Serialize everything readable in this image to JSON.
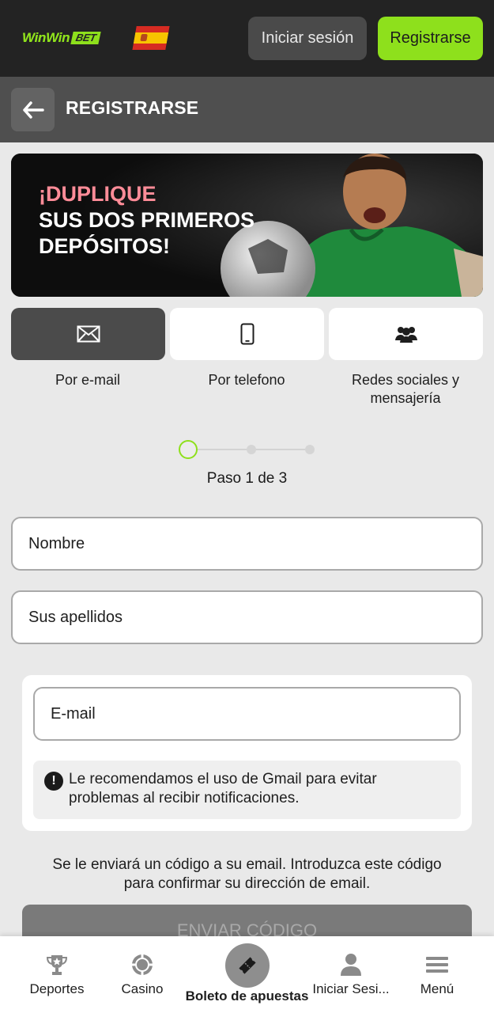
{
  "header": {
    "logo_win": "WinWin",
    "logo_bet": "BET",
    "login_label": "Iniciar sesión",
    "register_label": "Registrarse"
  },
  "subheader": {
    "title": "REGISTRARSE"
  },
  "banner": {
    "line1": "¡DUPLIQUE",
    "line2": "SUS DOS PRIMEROS",
    "line3": "DEPÓSITOS!"
  },
  "tabs": [
    {
      "label": "Por e-mail",
      "icon": "envelope-icon",
      "active": true
    },
    {
      "label": "Por telefono",
      "icon": "phone-icon",
      "active": false
    },
    {
      "label_l1": "Redes sociales y",
      "label_l2": "mensajería",
      "icon": "people-icon",
      "active": false
    }
  ],
  "stepper": {
    "label": "Paso 1 de 3",
    "current": 1,
    "total": 3
  },
  "form": {
    "first_name_placeholder": "Nombre",
    "last_name_placeholder": "Sus apellidos",
    "email_placeholder": "E-mail",
    "notice_l1": "Le recomendamos el uso de Gmail para evitar",
    "notice_l2": "problemas al recibir notificaciones.",
    "info_l1": "Se le enviará un código a su email. Introduzca este código",
    "info_l2": "para confirmar su dirección de email.",
    "send_label": "ENVIAR CÓDIGO"
  },
  "bottom_nav": {
    "sports": "Deportes",
    "casino": "Casino",
    "betslip": "Boleto de apuestas",
    "login": "Iniciar Sesi...",
    "menu": "Menú"
  },
  "colors": {
    "accent": "#8ee01c",
    "topbar": "#232323",
    "subbar": "#4f4f4f",
    "banner_highlight": "#ff8c98"
  }
}
